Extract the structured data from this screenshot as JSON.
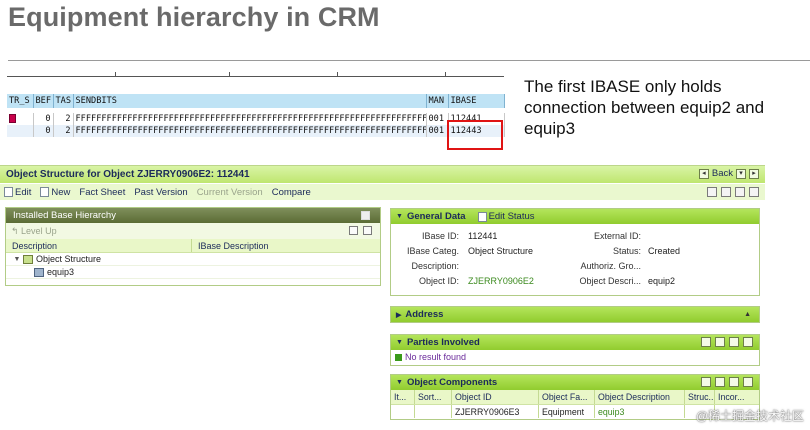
{
  "slide": {
    "title": "Equipment hierarchy in CRM",
    "note": "The first IBASE only holds connection between equip2 and equip3"
  },
  "sap_table": {
    "headers": [
      "TR_S",
      "BEF",
      "TAS",
      "SENDBITS",
      "MAN",
      "IBASE"
    ],
    "rows": [
      [
        "",
        "0",
        "2",
        "FFFFFFFFFFFFFFFFFFFFFFFFFFFFFFFFFFFFFFFFFFFFFFFFFFFFFFFFFFFFFFFFFFFFFFFFFFFFFFFF",
        "001",
        "112441"
      ],
      [
        "",
        "0",
        "2",
        "FFFFFFFFFFFFFFFFFFFFFFFFFFFFFFFFFFFFFFFFFFFFFFFFFFFFFFFFFFFFFFFFFFFFFFFFFFFFFFFF",
        "001",
        "112443"
      ]
    ],
    "highlight_color": "#e01414"
  },
  "crm": {
    "window_title": "Object Structure for Object ZJERRY0906E2: 112441",
    "back_label": "Back",
    "toolbar": [
      {
        "label": "Edit",
        "enabled": true
      },
      {
        "label": "New",
        "enabled": true
      },
      {
        "label": "Fact Sheet",
        "enabled": true
      },
      {
        "label": "Past Version",
        "enabled": true
      },
      {
        "label": "Current Version",
        "enabled": false
      },
      {
        "label": "Compare",
        "enabled": true
      }
    ],
    "installed_base": {
      "title": "Installed Base Hierarchy",
      "level_up": "Level Up",
      "columns": [
        "Description",
        "IBase Description"
      ],
      "rows": [
        {
          "label": "Object Structure"
        },
        {
          "label": "equip3"
        }
      ]
    },
    "general_data": {
      "title": "General Data",
      "edit_status": "Edit Status",
      "fields": [
        {
          "label1": "IBase ID:",
          "value1": "112441",
          "label2": "External ID:",
          "value2": ""
        },
        {
          "label1": "IBase Categ.",
          "value1": "Object Structure",
          "label2": "Status:",
          "value2": "Created"
        },
        {
          "label1": "Description:",
          "value1": "",
          "label2": "Authoriz. Gro...",
          "value2": ""
        },
        {
          "label1": "Object ID:",
          "value1": "ZJERRY0906E2",
          "label2": "Object Descri...",
          "value2": "equip2"
        }
      ]
    },
    "address": {
      "title": "Address"
    },
    "parties": {
      "title": "Parties Involved",
      "no_result": "No result found"
    },
    "object_components": {
      "title": "Object Components",
      "columns": [
        "It...",
        "Sort...",
        "Object ID",
        "Object Fa...",
        "Object Description",
        "Struc...",
        "Incor..."
      ],
      "rows": [
        [
          "",
          "",
          "ZJERRY0906E3",
          "Equipment",
          "equip3",
          "",
          ""
        ]
      ]
    },
    "colors": {
      "header_green": "#b4e55c",
      "panel_dark": "#5b6c35",
      "link_green": "#3b8a1e",
      "title_text": "#1b2a5a"
    }
  },
  "watermark": "@稀土掘金技术社区"
}
